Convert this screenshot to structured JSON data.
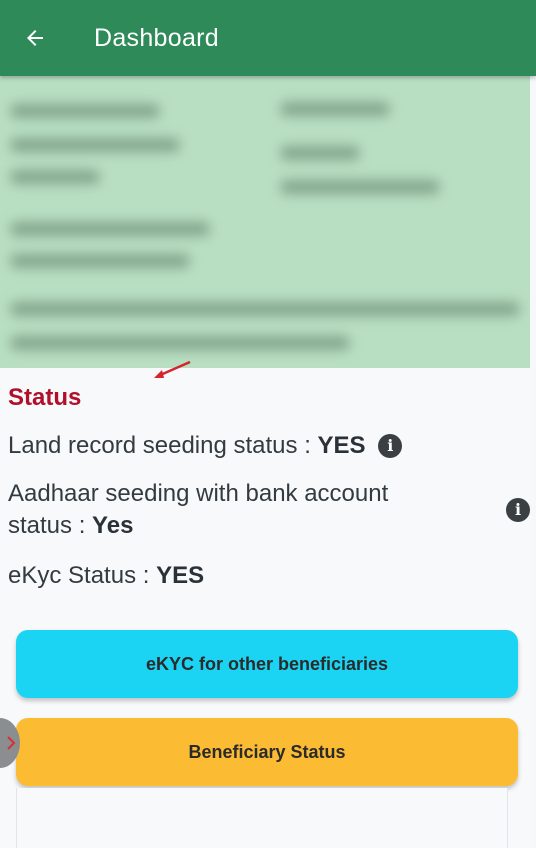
{
  "app_bar": {
    "title": "Dashboard",
    "back_icon": "arrow-left-icon",
    "color": "#2f8a5a"
  },
  "status": {
    "heading": "Status",
    "land_record": {
      "label": "Land record seeding status :",
      "value": "YES"
    },
    "aadhaar_seeding": {
      "label": "Aadhaar seeding with bank account",
      "label_cont": "status :",
      "value": "Yes"
    },
    "ekyc": {
      "label": "eKyc Status :",
      "value": "YES"
    },
    "info_icon": "i"
  },
  "buttons": {
    "ekyc_other": "eKYC for other beneficiaries",
    "beneficiary_status": "Beneficiary Status"
  },
  "colors": {
    "heading": "#b0102a",
    "ekyc_button": "#1bd4f4",
    "beneficiary_button": "#fbbb33",
    "profile_card": "#b9dfc2"
  }
}
